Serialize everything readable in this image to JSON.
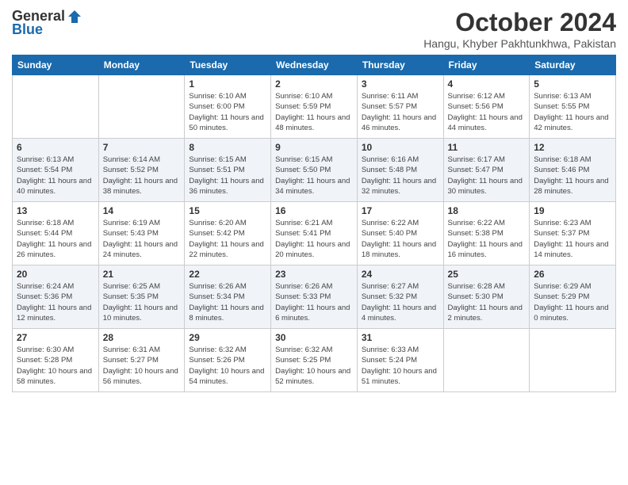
{
  "logo": {
    "general": "General",
    "blue": "Blue"
  },
  "title": "October 2024",
  "location": "Hangu, Khyber Pakhtunkhwa, Pakistan",
  "days_of_week": [
    "Sunday",
    "Monday",
    "Tuesday",
    "Wednesday",
    "Thursday",
    "Friday",
    "Saturday"
  ],
  "weeks": [
    [
      {
        "day": "",
        "info": ""
      },
      {
        "day": "",
        "info": ""
      },
      {
        "day": "1",
        "info": "Sunrise: 6:10 AM\nSunset: 6:00 PM\nDaylight: 11 hours and 50 minutes."
      },
      {
        "day": "2",
        "info": "Sunrise: 6:10 AM\nSunset: 5:59 PM\nDaylight: 11 hours and 48 minutes."
      },
      {
        "day": "3",
        "info": "Sunrise: 6:11 AM\nSunset: 5:57 PM\nDaylight: 11 hours and 46 minutes."
      },
      {
        "day": "4",
        "info": "Sunrise: 6:12 AM\nSunset: 5:56 PM\nDaylight: 11 hours and 44 minutes."
      },
      {
        "day": "5",
        "info": "Sunrise: 6:13 AM\nSunset: 5:55 PM\nDaylight: 11 hours and 42 minutes."
      }
    ],
    [
      {
        "day": "6",
        "info": "Sunrise: 6:13 AM\nSunset: 5:54 PM\nDaylight: 11 hours and 40 minutes."
      },
      {
        "day": "7",
        "info": "Sunrise: 6:14 AM\nSunset: 5:52 PM\nDaylight: 11 hours and 38 minutes."
      },
      {
        "day": "8",
        "info": "Sunrise: 6:15 AM\nSunset: 5:51 PM\nDaylight: 11 hours and 36 minutes."
      },
      {
        "day": "9",
        "info": "Sunrise: 6:15 AM\nSunset: 5:50 PM\nDaylight: 11 hours and 34 minutes."
      },
      {
        "day": "10",
        "info": "Sunrise: 6:16 AM\nSunset: 5:48 PM\nDaylight: 11 hours and 32 minutes."
      },
      {
        "day": "11",
        "info": "Sunrise: 6:17 AM\nSunset: 5:47 PM\nDaylight: 11 hours and 30 minutes."
      },
      {
        "day": "12",
        "info": "Sunrise: 6:18 AM\nSunset: 5:46 PM\nDaylight: 11 hours and 28 minutes."
      }
    ],
    [
      {
        "day": "13",
        "info": "Sunrise: 6:18 AM\nSunset: 5:44 PM\nDaylight: 11 hours and 26 minutes."
      },
      {
        "day": "14",
        "info": "Sunrise: 6:19 AM\nSunset: 5:43 PM\nDaylight: 11 hours and 24 minutes."
      },
      {
        "day": "15",
        "info": "Sunrise: 6:20 AM\nSunset: 5:42 PM\nDaylight: 11 hours and 22 minutes."
      },
      {
        "day": "16",
        "info": "Sunrise: 6:21 AM\nSunset: 5:41 PM\nDaylight: 11 hours and 20 minutes."
      },
      {
        "day": "17",
        "info": "Sunrise: 6:22 AM\nSunset: 5:40 PM\nDaylight: 11 hours and 18 minutes."
      },
      {
        "day": "18",
        "info": "Sunrise: 6:22 AM\nSunset: 5:38 PM\nDaylight: 11 hours and 16 minutes."
      },
      {
        "day": "19",
        "info": "Sunrise: 6:23 AM\nSunset: 5:37 PM\nDaylight: 11 hours and 14 minutes."
      }
    ],
    [
      {
        "day": "20",
        "info": "Sunrise: 6:24 AM\nSunset: 5:36 PM\nDaylight: 11 hours and 12 minutes."
      },
      {
        "day": "21",
        "info": "Sunrise: 6:25 AM\nSunset: 5:35 PM\nDaylight: 11 hours and 10 minutes."
      },
      {
        "day": "22",
        "info": "Sunrise: 6:26 AM\nSunset: 5:34 PM\nDaylight: 11 hours and 8 minutes."
      },
      {
        "day": "23",
        "info": "Sunrise: 6:26 AM\nSunset: 5:33 PM\nDaylight: 11 hours and 6 minutes."
      },
      {
        "day": "24",
        "info": "Sunrise: 6:27 AM\nSunset: 5:32 PM\nDaylight: 11 hours and 4 minutes."
      },
      {
        "day": "25",
        "info": "Sunrise: 6:28 AM\nSunset: 5:30 PM\nDaylight: 11 hours and 2 minutes."
      },
      {
        "day": "26",
        "info": "Sunrise: 6:29 AM\nSunset: 5:29 PM\nDaylight: 11 hours and 0 minutes."
      }
    ],
    [
      {
        "day": "27",
        "info": "Sunrise: 6:30 AM\nSunset: 5:28 PM\nDaylight: 10 hours and 58 minutes."
      },
      {
        "day": "28",
        "info": "Sunrise: 6:31 AM\nSunset: 5:27 PM\nDaylight: 10 hours and 56 minutes."
      },
      {
        "day": "29",
        "info": "Sunrise: 6:32 AM\nSunset: 5:26 PM\nDaylight: 10 hours and 54 minutes."
      },
      {
        "day": "30",
        "info": "Sunrise: 6:32 AM\nSunset: 5:25 PM\nDaylight: 10 hours and 52 minutes."
      },
      {
        "day": "31",
        "info": "Sunrise: 6:33 AM\nSunset: 5:24 PM\nDaylight: 10 hours and 51 minutes."
      },
      {
        "day": "",
        "info": ""
      },
      {
        "day": "",
        "info": ""
      }
    ]
  ]
}
